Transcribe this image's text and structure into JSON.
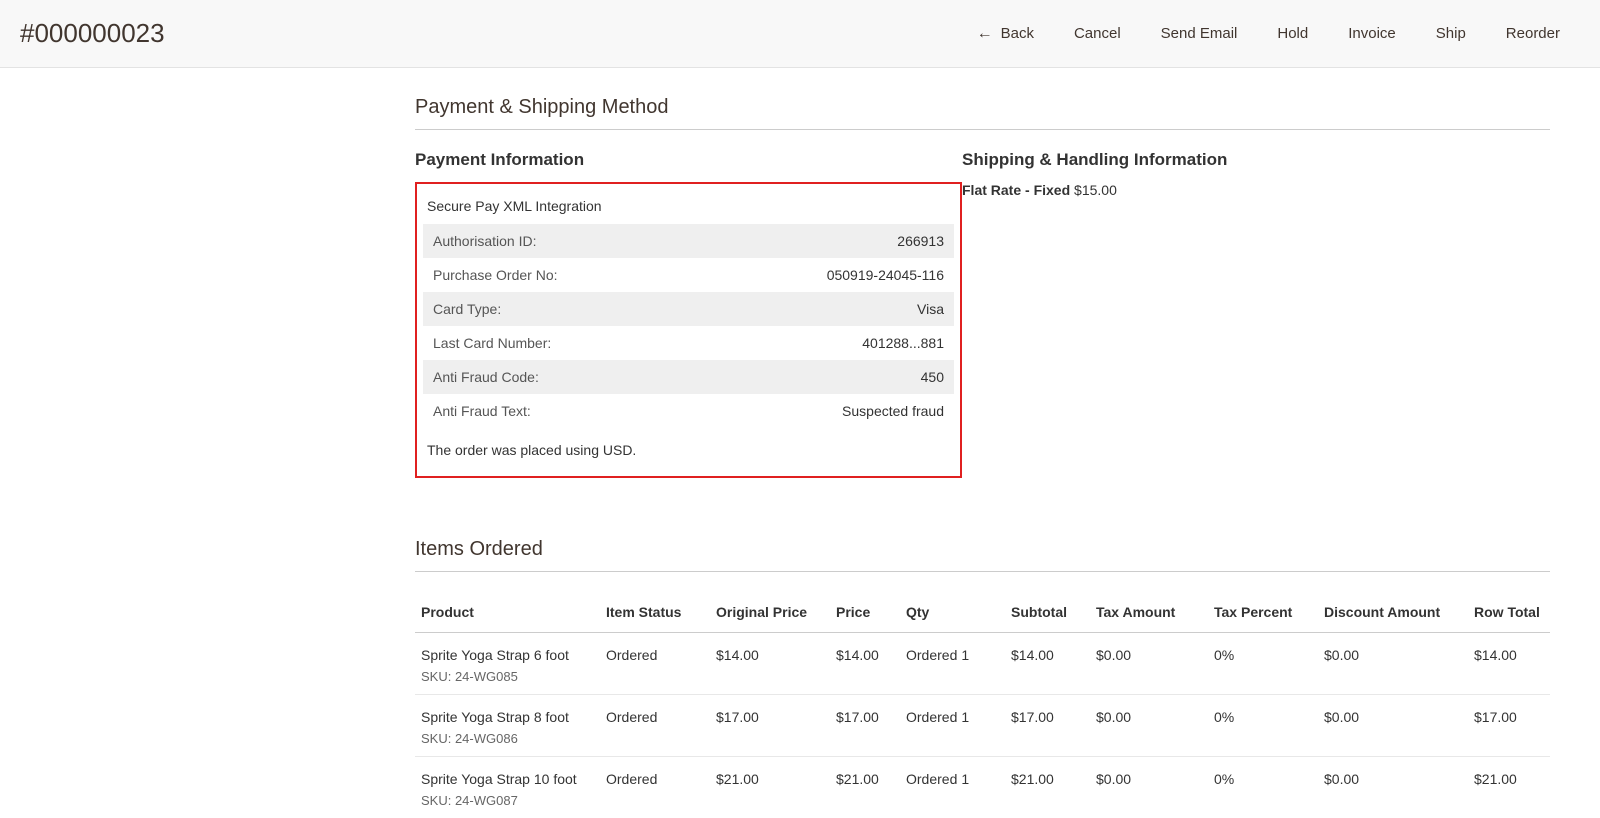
{
  "header": {
    "title": "#000000023",
    "actions": {
      "back": "Back",
      "cancel": "Cancel",
      "send_email": "Send Email",
      "hold": "Hold",
      "invoice": "Invoice",
      "ship": "Ship",
      "reorder": "Reorder"
    }
  },
  "sections": {
    "payment_shipping_title": "Payment & Shipping Method",
    "payment_info_title": "Payment Information",
    "shipping_info_title": "Shipping & Handling Information",
    "items_ordered_title": "Items Ordered"
  },
  "payment": {
    "method_name": "Secure Pay XML Integration",
    "rows": [
      {
        "label": "Authorisation ID:",
        "value": "266913"
      },
      {
        "label": "Purchase Order No:",
        "value": "050919-24045-116"
      },
      {
        "label": "Card Type:",
        "value": "Visa"
      },
      {
        "label": "Last Card Number:",
        "value": "401288...881"
      },
      {
        "label": "Anti Fraud Code:",
        "value": "450"
      },
      {
        "label": "Anti Fraud Text:",
        "value": "Suspected fraud"
      }
    ],
    "currency_note": "The order was placed using USD."
  },
  "shipping": {
    "label": "Flat Rate - Fixed",
    "amount": "$15.00"
  },
  "items": {
    "headers": {
      "product": "Product",
      "item_status": "Item Status",
      "original_price": "Original Price",
      "price": "Price",
      "qty": "Qty",
      "subtotal": "Subtotal",
      "tax_amount": "Tax Amount",
      "tax_percent": "Tax Percent",
      "discount_amount": "Discount Amount",
      "row_total": "Row Total"
    },
    "sku_prefix": "SKU:",
    "qty_label": "Ordered",
    "rows": [
      {
        "name": "Sprite Yoga Strap 6 foot",
        "sku": "24-WG085",
        "status": "Ordered",
        "original_price": "$14.00",
        "price": "$14.00",
        "qty": "1",
        "subtotal": "$14.00",
        "tax_amount": "$0.00",
        "tax_percent": "0%",
        "discount": "$0.00",
        "row_total": "$14.00"
      },
      {
        "name": "Sprite Yoga Strap 8 foot",
        "sku": "24-WG086",
        "status": "Ordered",
        "original_price": "$17.00",
        "price": "$17.00",
        "qty": "1",
        "subtotal": "$17.00",
        "tax_amount": "$0.00",
        "tax_percent": "0%",
        "discount": "$0.00",
        "row_total": "$17.00"
      },
      {
        "name": "Sprite Yoga Strap 10 foot",
        "sku": "24-WG087",
        "status": "Ordered",
        "original_price": "$21.00",
        "price": "$21.00",
        "qty": "1",
        "subtotal": "$21.00",
        "tax_amount": "$0.00",
        "tax_percent": "0%",
        "discount": "$0.00",
        "row_total": "$21.00"
      }
    ]
  }
}
